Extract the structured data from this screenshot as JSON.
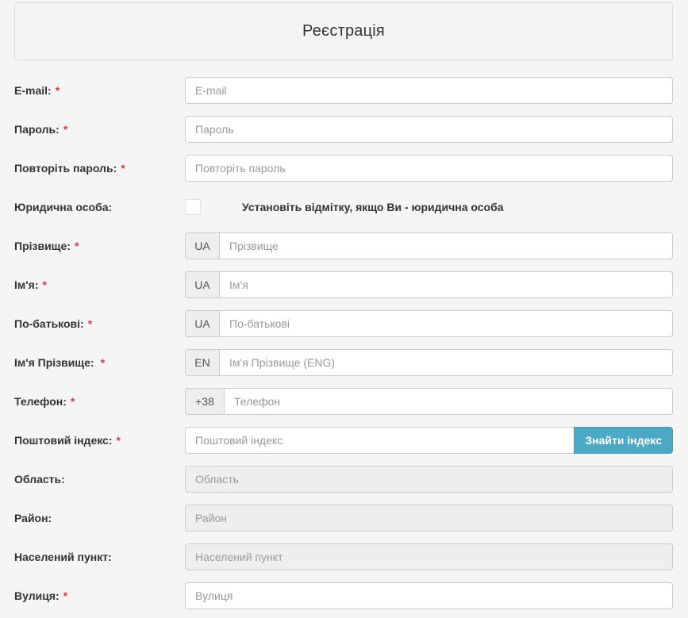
{
  "header": {
    "title": "Реєстрація"
  },
  "fields": {
    "email": {
      "label": "E-mail:",
      "required": "*",
      "placeholder": "E-mail"
    },
    "password": {
      "label": "Пароль:",
      "required": "*",
      "placeholder": "Пароль"
    },
    "password_repeat": {
      "label": "Повторіть пароль:",
      "required": "*",
      "placeholder": "Повторіть пароль"
    },
    "legal_entity": {
      "label": "Юридична особа:",
      "hint": "Установіть відмітку, якщо Ви - юридична особа"
    },
    "surname": {
      "label": "Прізвище:",
      "required": "*",
      "addon": "UA",
      "placeholder": "Прізвище"
    },
    "name": {
      "label": "Ім'я:",
      "required": "*",
      "addon": "UA",
      "placeholder": "Ім'я"
    },
    "patronymic": {
      "label": "По-батькові:",
      "required": "*",
      "addon": "UA",
      "placeholder": "По-батькові"
    },
    "name_en": {
      "label": "Ім'я Прізвище:",
      "required": "*",
      "addon": "EN",
      "placeholder": "Ім'я Прізвище (ENG)"
    },
    "phone": {
      "label": "Телефон:",
      "required": "*",
      "addon": "+38",
      "placeholder": "Телефон"
    },
    "postcode": {
      "label": "Поштовий індекс:",
      "required": "*",
      "placeholder": "Поштовий індекс",
      "button": "Знайти індекс"
    },
    "region": {
      "label": "Область:",
      "placeholder": "Область"
    },
    "district": {
      "label": "Район:",
      "placeholder": "Район"
    },
    "locality": {
      "label": "Населений пункт:",
      "placeholder": "Населений пункт"
    },
    "street": {
      "label": "Вулиця:",
      "required": "*",
      "placeholder": "Вулиця"
    }
  },
  "colors": {
    "required": "#e03a3a",
    "button": "#4aa9c4",
    "background": "#f5f5f5"
  }
}
